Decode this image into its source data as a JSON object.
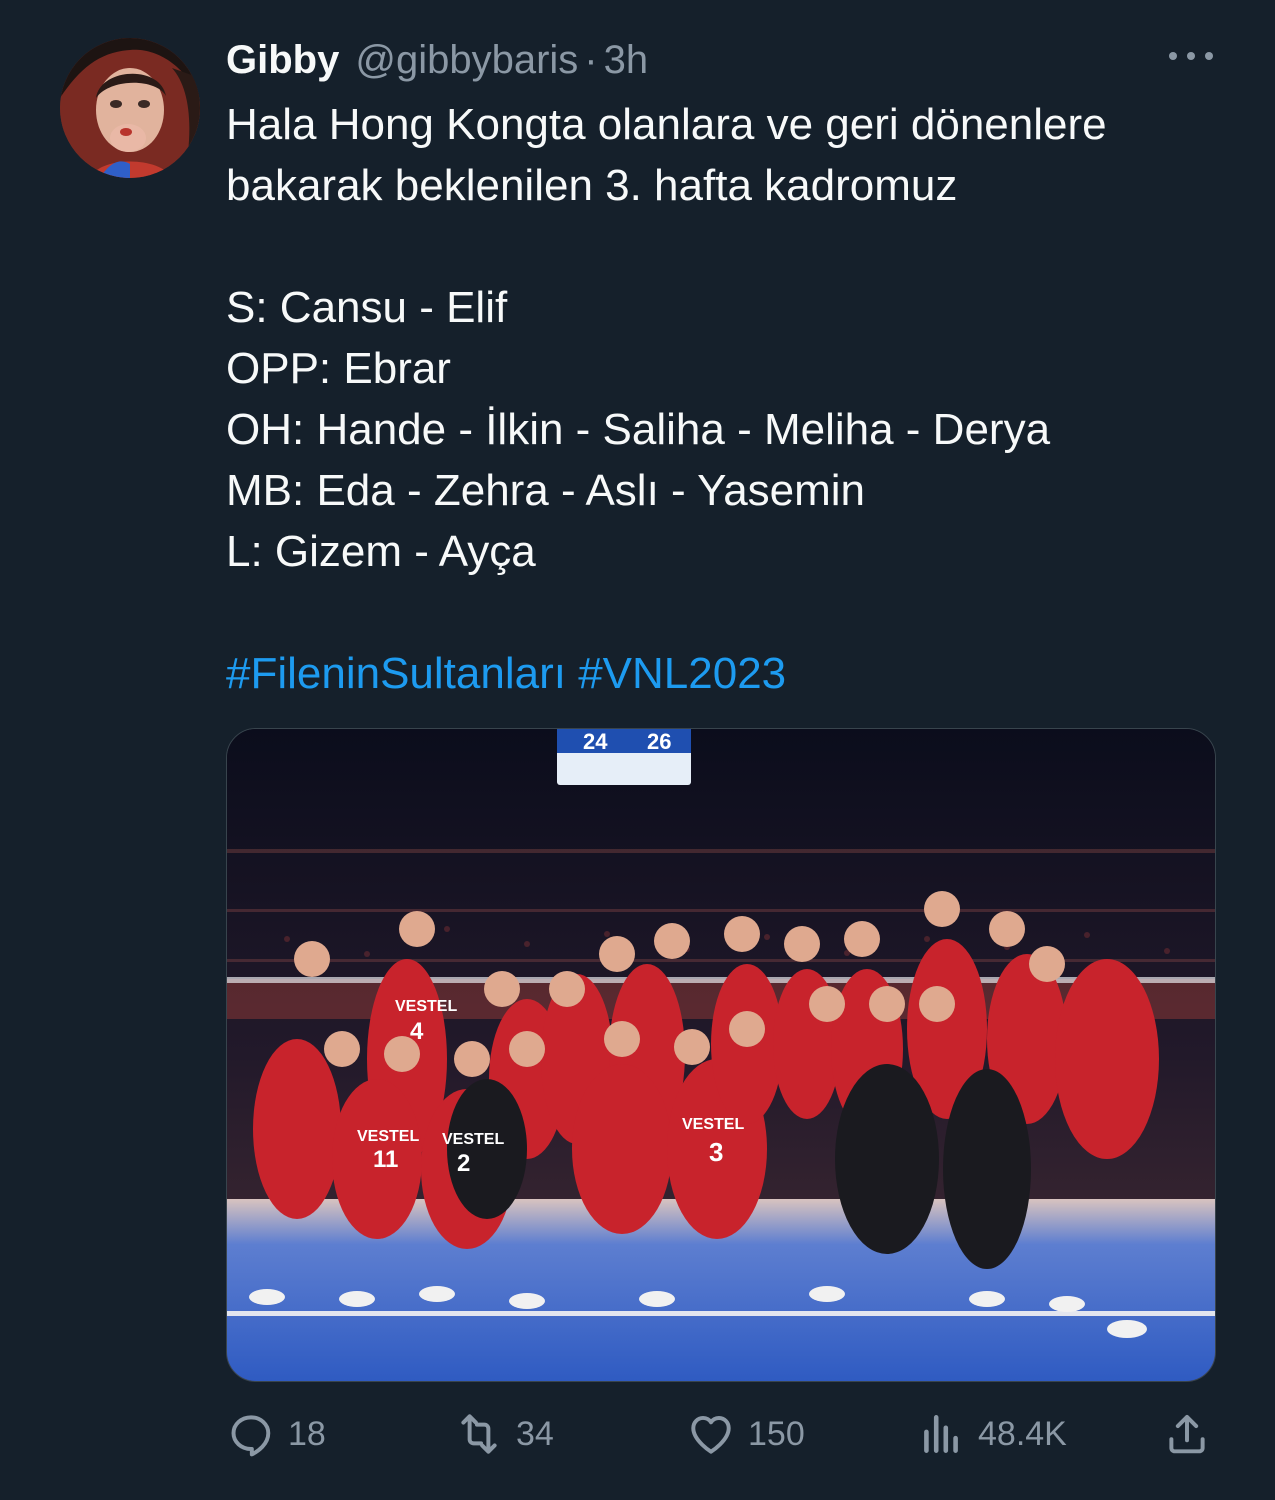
{
  "author": {
    "name": "Gibby",
    "handle": "@gibbybaris",
    "separator": "·",
    "time": "3h"
  },
  "tweet": {
    "lines": [
      "Hala Hong Kongta olanlara ve geri dönenlere",
      "bakarak beklenilen 3. hafta kadromuz",
      "",
      "S: Cansu - Elif",
      "OPP: Ebrar",
      "OH: Hande - İlkin - Saliha - Meliha - Derya",
      "MB: Eda - Zehra - Aslı - Yasemin",
      "L: Gizem - Ayça",
      ""
    ],
    "hashtags": "#FileninSultanları #VNL2023"
  },
  "media": {
    "scoreboard_left": "24",
    "scoreboard_right": "26",
    "jersey_brand": "VESTEL",
    "jersey_numbers": [
      "4",
      "11",
      "2",
      "3"
    ]
  },
  "actions": {
    "replies": "18",
    "retweets": "34",
    "likes": "150",
    "views": "48.4K"
  },
  "icons": {
    "reply": "reply-icon",
    "retweet": "retweet-icon",
    "like": "heart-icon",
    "views": "views-icon",
    "share": "share-icon",
    "more": "more-icon"
  },
  "colors": {
    "background": "#15202b",
    "text": "#f7f9f9",
    "secondary": "#8b98a5",
    "link": "#1d9bf0"
  }
}
